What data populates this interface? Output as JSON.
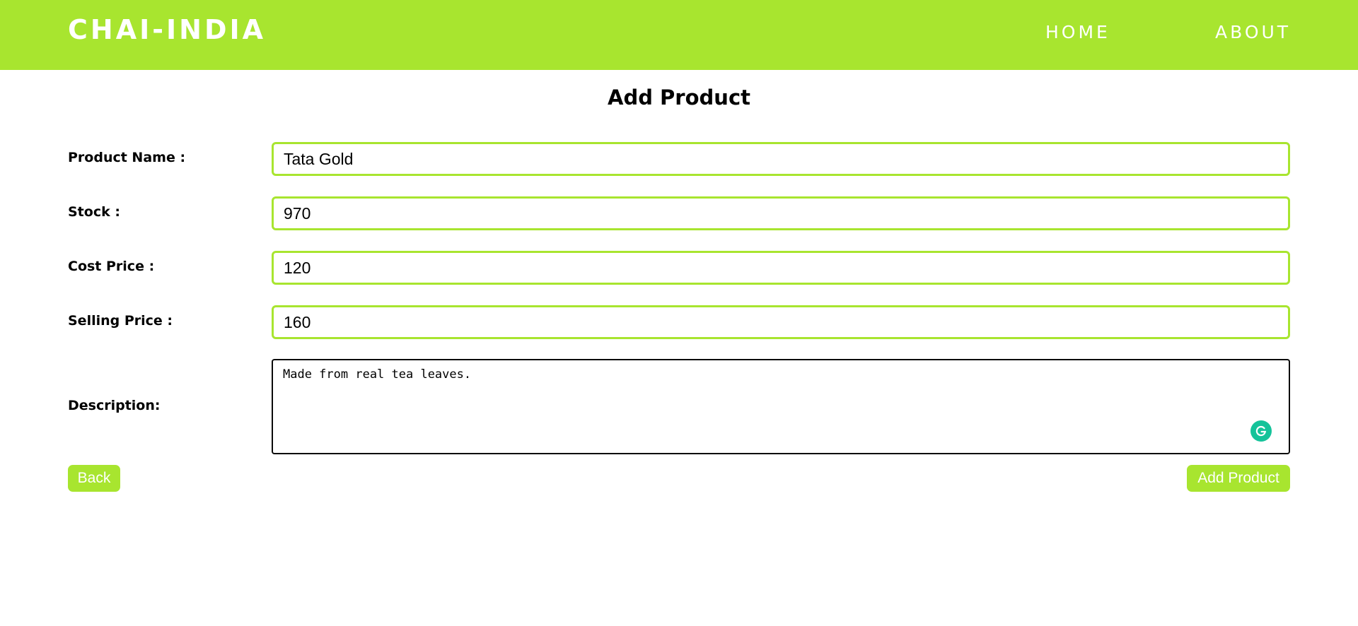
{
  "navbar": {
    "brand": "CHAI-INDIA",
    "links": [
      {
        "label": "HOME"
      },
      {
        "label": "ABOUT"
      }
    ]
  },
  "form": {
    "title": "Add Product",
    "fields": {
      "product_name": {
        "label": "Product Name :",
        "value": "Tata Gold"
      },
      "stock": {
        "label": "Stock :",
        "value": "970"
      },
      "cost_price": {
        "label": "Cost Price :",
        "value": "120"
      },
      "selling_price": {
        "label": "Selling Price :",
        "value": "160"
      },
      "description": {
        "label": "Description:",
        "value": "Made from real tea leaves."
      }
    },
    "buttons": {
      "back": "Back",
      "add": "Add Product"
    }
  },
  "colors": {
    "accent": "#a8e52f",
    "grammarly": "#15c39a"
  },
  "icons": {
    "grammarly": "grammarly-icon"
  }
}
